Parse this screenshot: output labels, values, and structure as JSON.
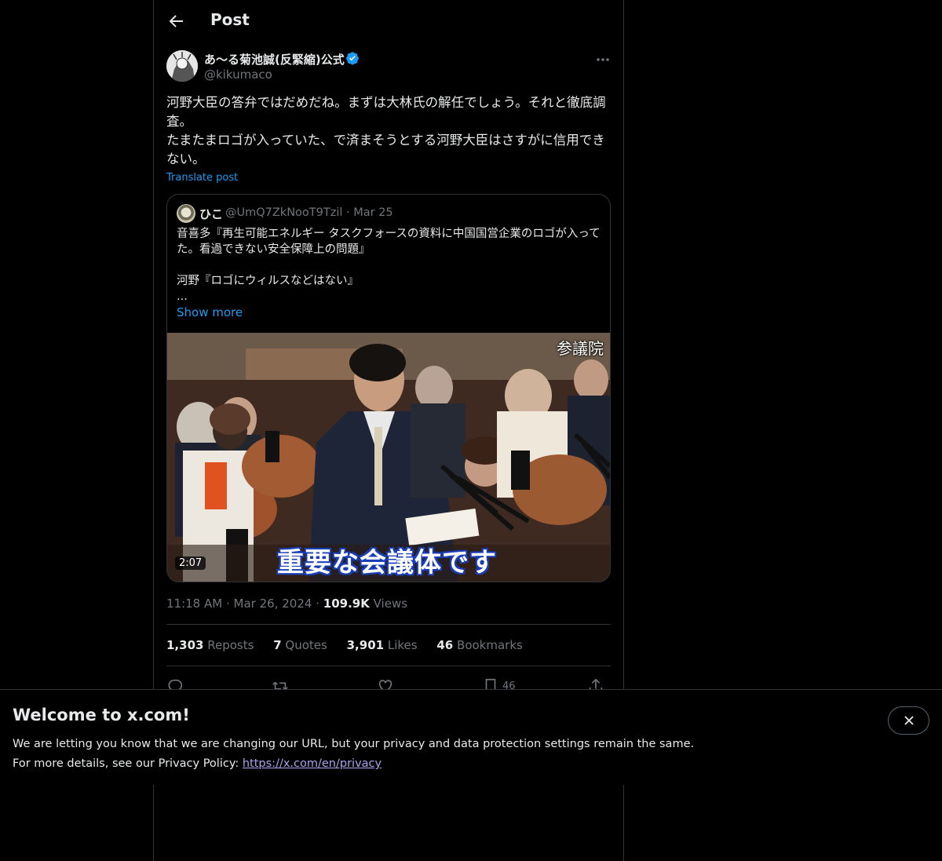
{
  "header": {
    "title": "Post"
  },
  "author": {
    "display_name": "あ〜る菊池誠(反緊縮)公式",
    "handle": "@kikumaco"
  },
  "post": {
    "lines": [
      "河野大臣の答弁ではだめだね。まずは大林氏の解任でしょう。それと徹底調査。",
      "たまたまロゴが入っていた、で済まそうとする河野大臣はさすがに信用できない。"
    ],
    "translate_label": "Translate post"
  },
  "quote": {
    "name": "ひこ",
    "handle": "@UmQ7ZkNooT9Tzil",
    "separator": "·",
    "date": "Mar 25",
    "text": "音喜多『再生可能エネルギー タスクフォースの資料に中国国営企業のロゴが入ってた。看過できない安全保障上の問題』\n\n河野『ロゴにウィルスなどはない』\n...",
    "show_more": "Show more",
    "video": {
      "watermark": "参議院",
      "caption": "重要な会議体です",
      "duration": "2:07"
    }
  },
  "meta": {
    "time": "11:18 AM",
    "dot1": "·",
    "date": "Mar 26, 2024",
    "dot2": "·",
    "views_count": "109.9K",
    "views_label": "Views"
  },
  "stats": {
    "reposts_count": "1,303",
    "reposts_label": "Reposts",
    "quotes_count": "7",
    "quotes_label": "Quotes",
    "likes_count": "3,901",
    "likes_label": "Likes",
    "bookmarks_count": "46",
    "bookmarks_label": "Bookmarks"
  },
  "actions": {
    "bookmark_count": "46"
  },
  "banner": {
    "title": "Welcome to x.com!",
    "line1": "We are letting you know that we are changing our URL, but your privacy and data protection settings remain the same.",
    "line2_prefix": "For more details, see our Privacy Policy: ",
    "link": "https://x.com/en/privacy"
  },
  "colors": {
    "accent": "#1d9bf0",
    "muted": "#71767b",
    "border": "#2f3336",
    "background": "#000000"
  }
}
